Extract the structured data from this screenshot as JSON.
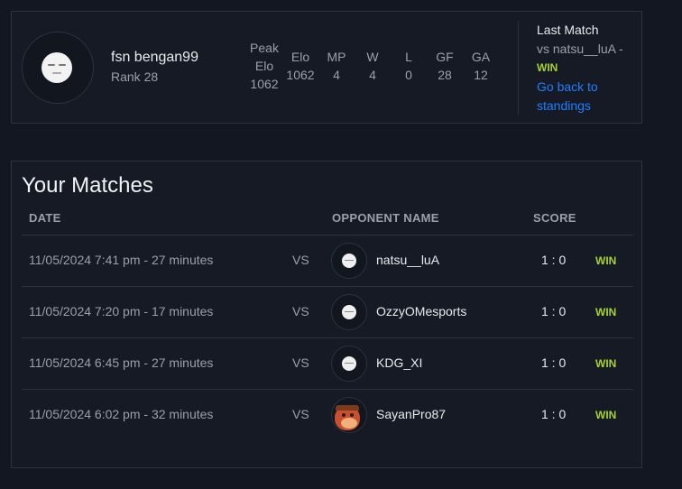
{
  "profile": {
    "name": "fsn bengan99",
    "rank": "Rank 28",
    "stats": {
      "peak_label_1": "Peak",
      "peak_label_2": "Elo",
      "peak_value": "1062",
      "elo_label": "Elo",
      "elo_value": "1062",
      "mp_label": "MP",
      "mp_value": "4",
      "w_label": "W",
      "w_value": "4",
      "l_label": "L",
      "l_value": "0",
      "gf_label": "GF",
      "gf_value": "28",
      "ga_label": "GA",
      "ga_value": "12"
    },
    "last_match": {
      "title": "Last Match",
      "vs_text": "vs natsu__luA -",
      "result": "WIN",
      "link_text": "Go back to standings"
    }
  },
  "matches": {
    "title": "Your Matches",
    "headers": {
      "date": "DATE",
      "opponent": "OPPONENT NAME",
      "score": "SCORE"
    },
    "rows": [
      {
        "date": "11/05/2024 7:41 pm - 27 minutes",
        "vs": "VS",
        "opponent": "natsu__luA",
        "score": "1 : 0",
        "result": "WIN"
      },
      {
        "date": "11/05/2024 7:20 pm - 17 minutes",
        "vs": "VS",
        "opponent": "OzzyOMesports",
        "score": "1 : 0",
        "result": "WIN"
      },
      {
        "date": "11/05/2024 6:45 pm - 27 minutes",
        "vs": "VS",
        "opponent": "KDG_XI",
        "score": "1 : 0",
        "result": "WIN"
      },
      {
        "date": "11/05/2024 6:02 pm - 32 minutes",
        "vs": "VS",
        "opponent": "SayanPro87",
        "score": "1 : 0",
        "result": "WIN"
      }
    ]
  },
  "colors": {
    "background": "#131722",
    "win": "#a6d32b",
    "link": "#1f7fff"
  }
}
